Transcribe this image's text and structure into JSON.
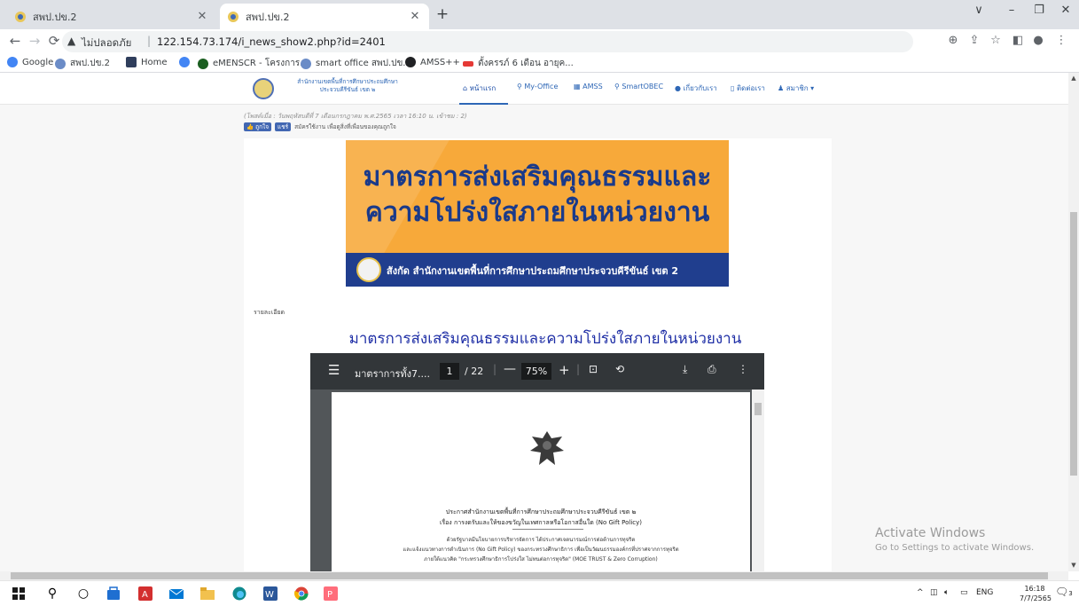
{
  "browser": {
    "tabs": [
      {
        "title": "สพป.ปข.2",
        "active": false
      },
      {
        "title": "สพป.ปข.2",
        "active": true
      }
    ],
    "new_tab": "+",
    "window_controls": {
      "collapse": "∨",
      "minimize": "–",
      "restore": "❐",
      "close": "✕"
    },
    "security_label": "ไม่ปลอดภัย",
    "url": "122.154.73.174/i_news_show2.php?id=2401",
    "bookmarks": [
      {
        "label": "Google",
        "color": "#4285f4"
      },
      {
        "label": "สพป.ปข.2",
        "color": "#6b8cc7"
      },
      {
        "label": "Home",
        "color": "#2f3e5c"
      },
      {
        "label": "",
        "color": "#4285f4"
      },
      {
        "label": "eMENSCR - โครงการ...",
        "color": "#1b5e20"
      },
      {
        "label": "smart office สพป.ปข.2",
        "color": "#6b8cc7"
      },
      {
        "label": "AMSS++",
        "color": "#202124"
      },
      {
        "label": "ตั้งครรภ์ 6 เดือน อายุค...",
        "color": "#e53935"
      }
    ]
  },
  "site": {
    "brand_line1": "สำนักงานเขตพื้นที่การศึกษาประถมศึกษา",
    "brand_line2": "ประจวบคีรีขันธ์ เขต ๒",
    "nav": [
      {
        "label": "หน้าแรก",
        "icon": "home-icon"
      },
      {
        "label": "My-Office",
        "icon": "link-icon"
      },
      {
        "label": "AMSS",
        "icon": "grid-icon"
      },
      {
        "label": "SmartOBEC",
        "icon": "link-icon"
      },
      {
        "label": "เกี่ยวกับเรา",
        "icon": "info-icon"
      },
      {
        "label": "ติดต่อเรา",
        "icon": "phone-icon"
      },
      {
        "label": "สมาชิก",
        "icon": "user-icon"
      }
    ],
    "post_meta": "(โพสต์เมื่อ : วันพฤหัสบดีที่ 7 เดือนกรกฎาคม พ.ศ.2565 เวลา 16:10 น. เข้าชม : 2)",
    "fb_like": "ถูกใจ",
    "fb_share": "แชร์",
    "fb_text": "สมัครใช้งาน เพื่อดูสิ่งที่เพื่อนของคุณถูกใจ",
    "banner": {
      "line1": "มาตรการส่งเสริมคุณธรรมและ",
      "line2": "ความโปร่งใสภายในหน่วยงาน",
      "subtitle": "สังกัด สำนักงานเขตพื้นที่การศึกษาประถมศึกษาประจวบคีรีขันธ์ เขต 2"
    },
    "detail_label": "รายละเอียด",
    "article_title": "มาตรการส่งเสริมคุณธรรมและความโปร่งใสภายในหน่วยงาน"
  },
  "pdf": {
    "filename": "มาตราการทั้ง7....",
    "page": "1",
    "total": "/ 22",
    "zoom": "75%",
    "doc_title1": "ประกาศสำนักงานเขตพื้นที่การศึกษาประถมศึกษาประจวบคีรีขันธ์ เขต ๒",
    "doc_title2": "เรื่อง การงดรับและให้ของขวัญในเทศกาลหรือโอกาสอื่นใด (No Gift Policy)",
    "doc_body1": "ด้วยรัฐบาลมีนโยบายการบริหารจัดการ ได้ประกาศเจตนารมณ์การต่อต้านการทุจริต",
    "doc_body2": "และแจ้งแนวทางการดำเนินการ (No Gift Policy) ของกระทรวงศึกษาธิการ เพื่อเป็นวัฒนธรรมองค์กรที่ปราศจากการทุจริต",
    "doc_body3": "ภายใต้แนวคิด \"กระทรวงศึกษาธิการโปร่งใส ไม่ทนต่อการทุจริต\" (MOE TRUST & Zero Corruption)"
  },
  "watermark": {
    "line1": "Activate Windows",
    "line2": "Go to Settings to activate Windows."
  },
  "taskbar": {
    "lang": "ENG",
    "time": "16:18",
    "date": "7/7/2565",
    "notifications": "3"
  }
}
